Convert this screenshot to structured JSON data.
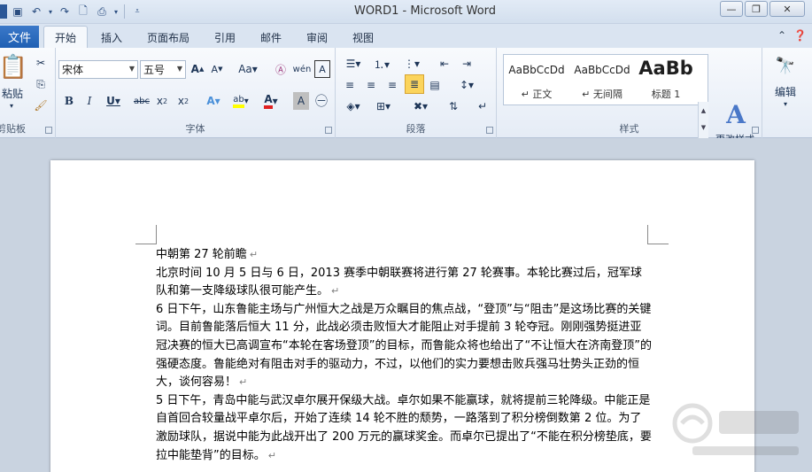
{
  "window": {
    "title": "WORD1 - Microsoft Word"
  },
  "tabs": [
    {
      "id": "file",
      "label": "文件"
    },
    {
      "id": "home",
      "label": "开始"
    },
    {
      "id": "insert",
      "label": "插入"
    },
    {
      "id": "layout",
      "label": "页面布局"
    },
    {
      "id": "refs",
      "label": "引用"
    },
    {
      "id": "mail",
      "label": "邮件"
    },
    {
      "id": "review",
      "label": "审阅"
    },
    {
      "id": "view",
      "label": "视图"
    }
  ],
  "ribbon": {
    "clipboard": {
      "label": "剪贴板",
      "paste_label": "粘贴"
    },
    "font": {
      "label": "字体",
      "font_name": "宋体",
      "font_size": "五号"
    },
    "paragraph": {
      "label": "段落"
    },
    "styles": {
      "label": "样式",
      "items": [
        {
          "sample": "AaBbCcDd",
          "name": "↵ 正文"
        },
        {
          "sample": "AaBbCcDd",
          "name": "↵ 无间隔"
        },
        {
          "sample": "AaBb",
          "name": "标题 1"
        }
      ],
      "change_styles_label": "更改样式"
    },
    "editing": {
      "label": "编辑"
    }
  },
  "document": {
    "paragraphs": [
      "中朝第 27 轮前瞻",
      "北京时间 10 月 5 日与 6 日，2013 赛季中朝联赛将进行第 27 轮赛事。本轮比赛过后，冠军球队和第一支降级球队很可能产生。",
      "6 日下午，山东鲁能主场与广州恒大之战是万众瞩目的焦点战，“登顶”与“阻击”是这场比赛的关键词。目前鲁能落后恒大 11 分，此战必须击败恒大才能阻止对手提前 3 轮夺冠。刚刚强势挺进亚冠决赛的恒大已高调宣布“本轮在客场登顶”的目标，而鲁能众将也给出了“不让恒大在济南登顶”的强硬态度。鲁能绝对有阻击对手的驱动力，不过，以他们的实力要想击败兵强马壮势头正劲的恒大，谈何容易！",
      "5 日下午，青岛中能与武汉卓尔展开保级大战。卓尔如果不能赢球，就将提前三轮降级。中能正是自首回合较量战平卓尔后，开始了连续 14 轮不胜的颓势，一路落到了积分榜倒数第 2 位。为了激励球队，据说中能为此战开出了 200 万元的赢球奖金。而卓尔已提出了“不能在积分榜垫底，要拉中能垫背”的目标。"
    ]
  }
}
